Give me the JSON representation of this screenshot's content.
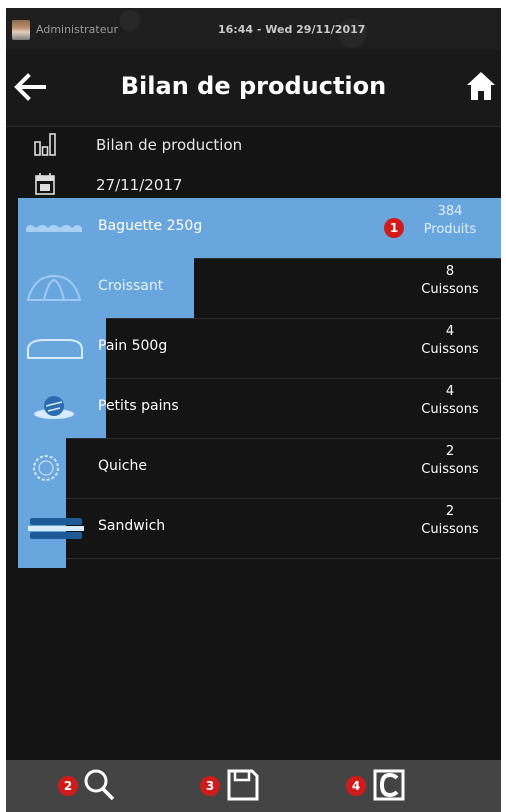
{
  "status": {
    "user": "Administrateur",
    "datetime": "16:44 - Wed 29/11/2017"
  },
  "header": {
    "title": "Bilan de production"
  },
  "info": {
    "report_label": "Bilan de production",
    "date": "27/11/2017"
  },
  "products": [
    {
      "name": "Baguette 250g",
      "count": "384",
      "unit": "Produits"
    },
    {
      "name": "Croissant",
      "count": "8",
      "unit": "Cuissons"
    },
    {
      "name": "Pain 500g",
      "count": "4",
      "unit": "Cuissons"
    },
    {
      "name": "Petits pains",
      "count": "4",
      "unit": "Cuissons"
    },
    {
      "name": "Quiche",
      "count": "2",
      "unit": "Cuissons"
    },
    {
      "name": "Sandwich",
      "count": "2",
      "unit": "Cuissons"
    }
  ],
  "callouts": {
    "first": "1",
    "search": "2",
    "save": "3",
    "clear": "4"
  },
  "colors": {
    "highlight": "#6aa6de",
    "badge": "#d11a1a",
    "background": "#141414",
    "bottombar": "#444444"
  },
  "icons": {
    "back": "arrow-left-icon",
    "home": "home-icon",
    "chart": "bar-chart-icon",
    "calendar": "calendar-icon",
    "search": "search-icon",
    "save": "save-icon",
    "clear": "clear-icon"
  }
}
